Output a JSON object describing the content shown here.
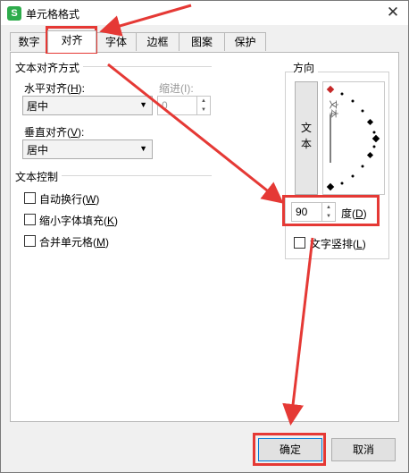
{
  "window": {
    "title": "单元格格式",
    "app_icon_glyph": "S",
    "close_glyph": "✕"
  },
  "tabs": [
    {
      "label": "数字"
    },
    {
      "label": "对齐"
    },
    {
      "label": "字体"
    },
    {
      "label": "边框"
    },
    {
      "label": "图案"
    },
    {
      "label": "保护"
    }
  ],
  "active_tab": "对齐",
  "alignment": {
    "section_title": "文本对齐方式",
    "horizontal_label": "水平对齐(",
    "horizontal_key": "H",
    "horizontal_tail": "):",
    "horizontal_value": "居中",
    "indent_label": "缩进(I):",
    "indent_value": "0",
    "vertical_label": "垂直对齐(",
    "vertical_key": "V",
    "vertical_tail": "):",
    "vertical_value": "居中"
  },
  "text_control": {
    "section_title": "文本控制",
    "wrap": {
      "pre": "自动换行(",
      "key": "W",
      "post": ")"
    },
    "shrink": {
      "pre": "缩小字体填充(",
      "key": "K",
      "post": ")"
    },
    "merge": {
      "pre": "合并单元格(",
      "key": "M",
      "post": ")"
    }
  },
  "orientation": {
    "section_title": "方向",
    "vertical_text_button": "文本",
    "dial_text": "文本",
    "degree_value": "90",
    "degree_pre": "度(",
    "degree_key": "D",
    "degree_post": ")",
    "vertical_text_checkbox": {
      "pre": "文字竖排(",
      "key": "L",
      "post": ")"
    }
  },
  "footer": {
    "ok": "确定",
    "cancel": "取消"
  },
  "colors": {
    "highlight": "#e53935",
    "dial_marker": "#c62828"
  }
}
